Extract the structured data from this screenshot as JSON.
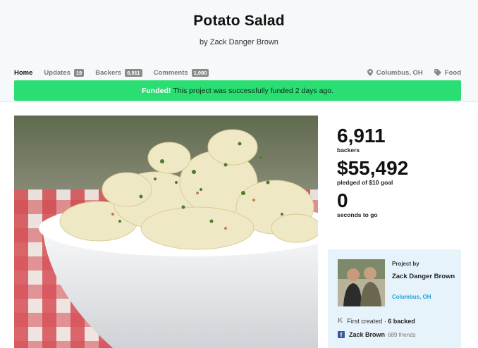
{
  "project": {
    "title": "Potato Salad",
    "byline": "by Zack Danger Brown"
  },
  "nav": {
    "tabs": [
      {
        "label": "Home",
        "count": null
      },
      {
        "label": "Updates",
        "count": "19"
      },
      {
        "label": "Backers",
        "count": "6,911"
      },
      {
        "label": "Comments",
        "count": "1,080"
      }
    ],
    "location": "Columbus, OH",
    "category": "Food"
  },
  "banner": {
    "strong": "Funded!",
    "text": "This project was successfully funded 2 days ago.",
    "color": "#2bde73"
  },
  "stats": {
    "backers_value": "6,911",
    "backers_label": "backers",
    "pledged_value": "$55,492",
    "pledged_label": "pledged of $10 goal",
    "time_value": "0",
    "time_label": "seconds to go"
  },
  "creator": {
    "project_by": "Project by",
    "name": "Zack Danger Brown",
    "location": "Columbus, OH",
    "created_prefix": "First created",
    "backed": "6 backed",
    "facebook_name": "Zack Brown",
    "facebook_friends": "689 friends"
  },
  "icons": [
    "map-pin-icon",
    "tag-icon",
    "kickstarter-icon",
    "facebook-icon"
  ]
}
